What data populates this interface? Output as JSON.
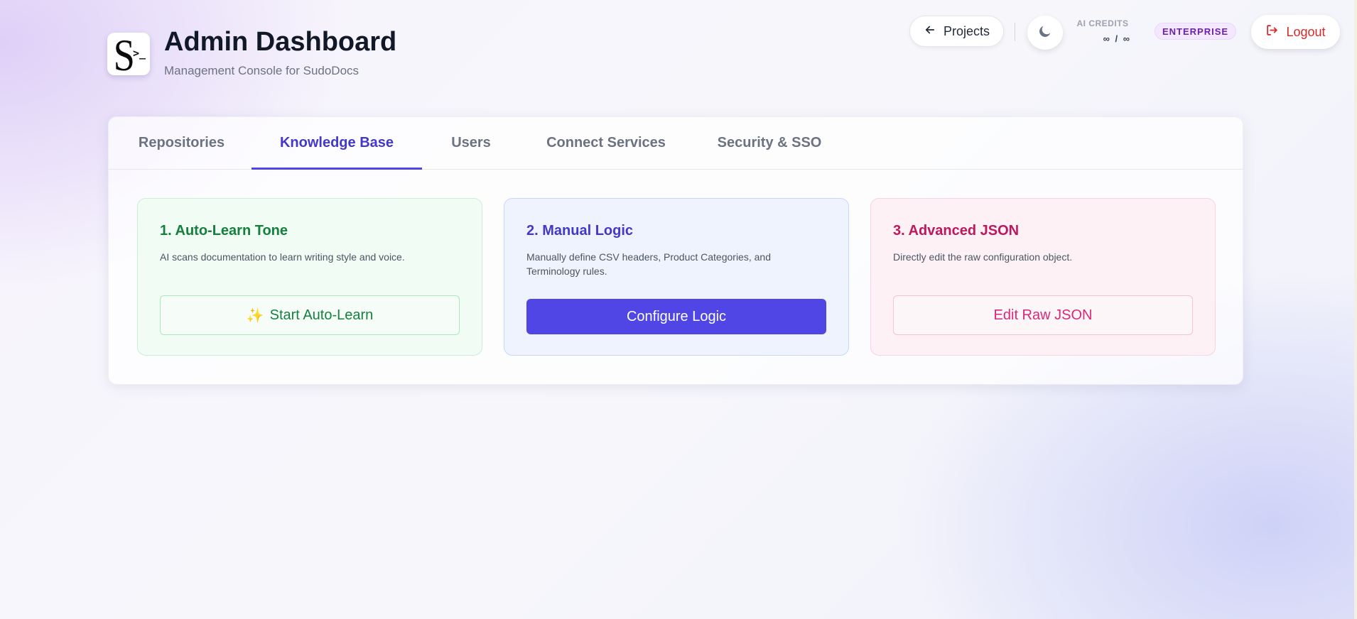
{
  "header": {
    "title": "Admin Dashboard",
    "subtitle": "Management Console for SudoDocs",
    "logo_letter": "S",
    "logo_prompt": ">_",
    "projects_label": "Projects",
    "credits_label": "AI CREDITS",
    "credits_value": "∞ / ∞",
    "plan_badge": "ENTERPRISE",
    "logout_label": "Logout"
  },
  "tabs": [
    {
      "label": "Repositories",
      "active": false
    },
    {
      "label": "Knowledge Base",
      "active": true
    },
    {
      "label": "Users",
      "active": false
    },
    {
      "label": "Connect Services",
      "active": false
    },
    {
      "label": "Security & SSO",
      "active": false
    }
  ],
  "cards": [
    {
      "title": "1. Auto-Learn Tone",
      "description": "AI scans documentation to learn writing style and voice.",
      "button_icon": "✨",
      "button_label": "Start Auto-Learn"
    },
    {
      "title": "2. Manual Logic",
      "description": "Manually define CSV headers, Product Categories, and Terminology rules.",
      "button_label": "Configure Logic"
    },
    {
      "title": "3. Advanced JSON",
      "description": "Directly edit the raw configuration object.",
      "button_label": "Edit Raw JSON"
    }
  ],
  "icons": {
    "projects": "arrow-left-icon",
    "theme": "moon-icon",
    "logout": "logout-icon"
  },
  "colors": {
    "accent": "#4f46e5",
    "active_tab": "#4338ca",
    "green": "#15803d",
    "pink": "#db2777",
    "logout": "#dc2626",
    "badge_text": "#6b21a8"
  }
}
